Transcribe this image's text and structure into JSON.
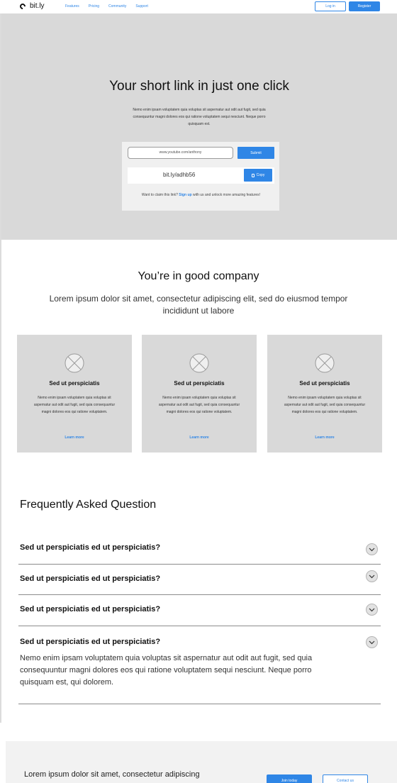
{
  "nav": {
    "logo_text": "bit.ly",
    "links": [
      "Features",
      "Pricing",
      "Community",
      "Support"
    ],
    "login_label": "Log in",
    "register_label": "Register"
  },
  "hero": {
    "title": "Your short link in just one click",
    "subtitle": "Nemo enim ipsam voluptatem quia voluptas sit aspernatur aut odit aut fugit, sed quia consequuntur magni dolores eos qui ratione voluptatem sequi nesciunt. Neque porro quisquam est.",
    "input_value": "www.youtube.com/anthony",
    "submit_label": "Submit",
    "short_link": "bit.ly/adhb56",
    "copy_label": "Copy",
    "claim_prefix": "Want to claim this link?",
    "claim_link": "Sign up",
    "claim_suffix": "with us and unlock more amazing features!"
  },
  "company": {
    "title": "You’re in good company",
    "subtitle": "Lorem ipsum dolor sit amet, consectetur adipiscing elit, sed do eiusmod tempor incididunt ut labore",
    "features": [
      {
        "title": "Sed ut perspiciatis",
        "text": "Nemo enim ipsam voluptatem quia voluptas sit aspernatur aut odit aut fugit, sed quia consequuntur magni dolores eos qui ratione voluptatem.",
        "link": "Learn more"
      },
      {
        "title": "Sed ut perspiciatis",
        "text": "Nemo enim ipsam voluptatem quia voluptas sit aspernatur aut odit aut fugit, sed quia consequuntur magni dolores eos qui ratione voluptatem.",
        "link": "Learn more"
      },
      {
        "title": "Sed ut perspiciatis",
        "text": "Nemo enim ipsam voluptatem quia voluptas sit aspernatur aut odit aut fugit, sed quia consequuntur magni dolores eos qui ratione voluptatem.",
        "link": "Learn more"
      }
    ]
  },
  "faq": {
    "title": "Frequently Asked Question",
    "items": [
      {
        "question": "Sed ut perspiciatis ed ut perspiciatis?"
      },
      {
        "question": "Sed ut perspiciatis ed ut perspiciatis?"
      },
      {
        "question": "Sed ut perspiciatis ed ut perspiciatis?"
      },
      {
        "question": "Sed ut perspiciatis ed ut perspiciatis?",
        "answer": "Nemo enim ipsam voluptatem quia voluptas sit aspernatur aut odit aut fugit, sed quia consequuntur magni dolores eos qui ratione voluptatem sequi nesciunt. Neque porro quisquam est, qui dolorem."
      }
    ]
  },
  "cta": {
    "text": "Lorem ipsum dolor sit amet, consectetur adipiscing",
    "primary_label": "Join today",
    "secondary_label": "Contact us"
  },
  "colors": {
    "accent": "#2f86e6",
    "hero_bg": "#d9d9d9",
    "card_bg": "#d9d9d9"
  },
  "icons": [
    "logo-mark-icon",
    "copy-icon",
    "image-placeholder-icon",
    "chevron-down-icon"
  ]
}
